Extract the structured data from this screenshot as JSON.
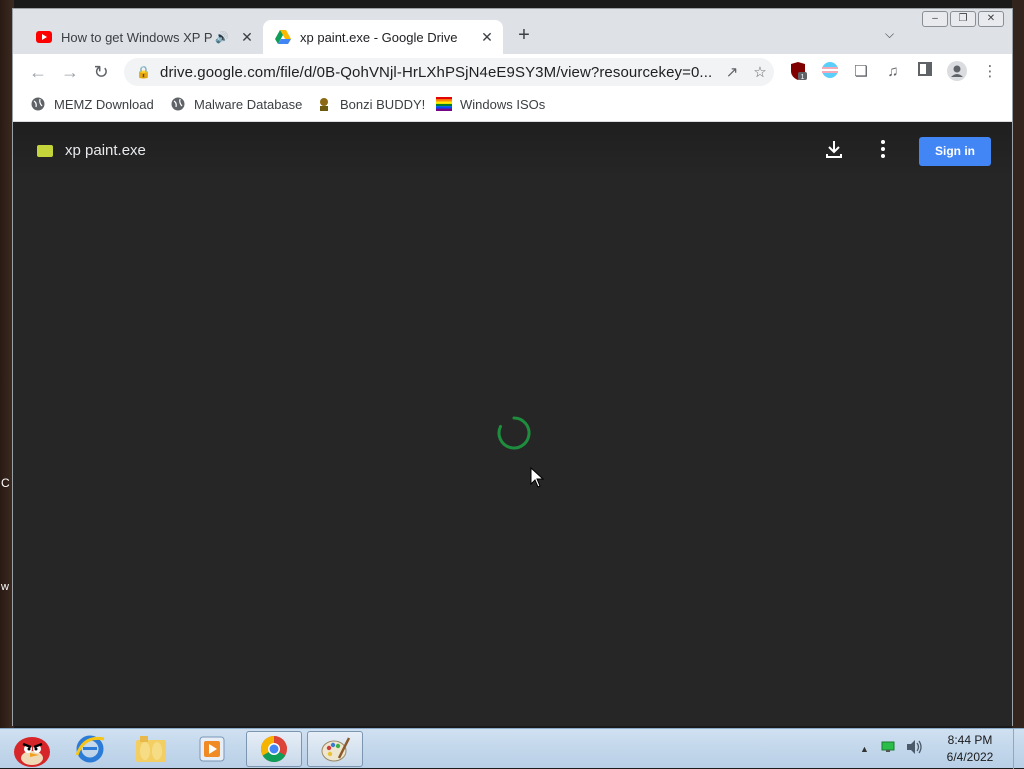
{
  "browser": {
    "tabs": [
      {
        "title": "How to get Windows XP P",
        "favicon": "youtube-icon",
        "audio": true,
        "active": false
      },
      {
        "title": "xp paint.exe - Google Drive",
        "favicon": "google-drive-icon",
        "active": true
      }
    ],
    "new_tab": "+",
    "address": "drive.google.com/file/d/0B-QohVNjl-HrLXhPSjN4eE9SY3M/view?resourcekey=0...",
    "bookmarks": [
      {
        "label": "MEMZ Download",
        "icon": "globe-icon"
      },
      {
        "label": "Malware Database",
        "icon": "globe-icon"
      },
      {
        "label": "Bonzi BUDDY!",
        "icon": "bonzi-icon"
      },
      {
        "label": "Windows ISOs",
        "icon": "rainbow-flag-icon"
      }
    ],
    "extension_badge": "1"
  },
  "drive": {
    "filename": "xp paint.exe",
    "signin_label": "Sign in",
    "loading": true
  },
  "taskbar": {
    "time": "8:44 PM",
    "date": "6/4/2022",
    "pinned": [
      "angry-birds-icon",
      "internet-explorer-icon",
      "folders-icon",
      "media-player-icon",
      "chrome-icon",
      "paint-icon"
    ]
  },
  "desktop": {
    "fragments": [
      "C",
      "w"
    ]
  },
  "colors": {
    "drive_bg": "#262626",
    "signin": "#4285f4",
    "spinner": "#1e8e3e"
  }
}
